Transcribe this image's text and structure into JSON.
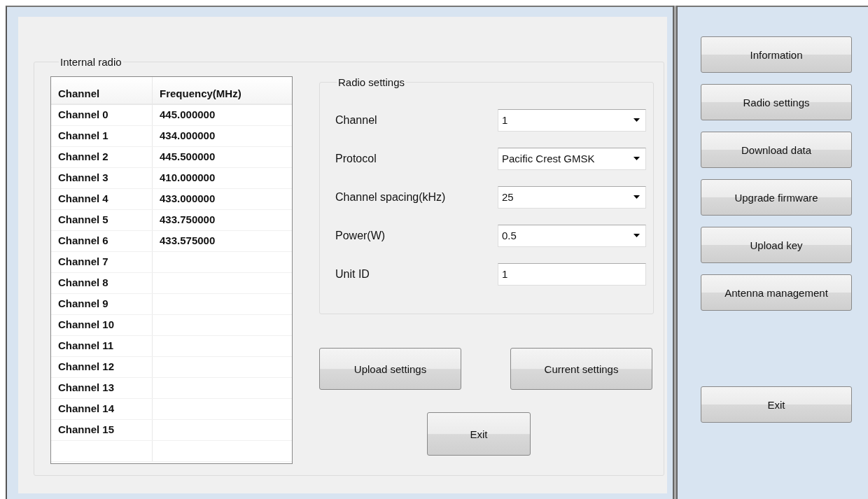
{
  "internal_radio": {
    "title": "Internal radio",
    "table": {
      "columns": [
        "Channel",
        "Frequency(MHz)"
      ],
      "rows": [
        {
          "channel": "Channel 0",
          "frequency": "445.000000"
        },
        {
          "channel": "Channel 1",
          "frequency": "434.000000"
        },
        {
          "channel": "Channel 2",
          "frequency": "445.500000"
        },
        {
          "channel": "Channel 3",
          "frequency": "410.000000"
        },
        {
          "channel": "Channel 4",
          "frequency": "433.000000"
        },
        {
          "channel": "Channel 5",
          "frequency": "433.750000"
        },
        {
          "channel": "Channel 6",
          "frequency": "433.575000"
        },
        {
          "channel": "Channel 7"
        },
        {
          "channel": "Channel 8"
        },
        {
          "channel": "Channel 9"
        },
        {
          "channel": "Channel 10"
        },
        {
          "channel": "Channel 11"
        },
        {
          "channel": "Channel 12"
        },
        {
          "channel": "Channel 13"
        },
        {
          "channel": "Channel 14"
        },
        {
          "channel": "Channel 15"
        }
      ]
    },
    "radio_settings": {
      "title": "Radio settings",
      "fields": [
        {
          "label": "Channel",
          "value": "1",
          "kind": "dropdown"
        },
        {
          "label": "Protocol",
          "value": "Pacific Crest GMSK",
          "kind": "dropdown"
        },
        {
          "label": "Channel spacing(kHz)",
          "value": "25",
          "kind": "dropdown"
        },
        {
          "label": "Power(W)",
          "value": "0.5",
          "kind": "dropdown"
        },
        {
          "label": "Unit ID",
          "value": "1",
          "kind": "text"
        }
      ]
    },
    "buttons": [
      "Upload settings",
      "Current settings"
    ],
    "exit_button": "Exit"
  },
  "sidebar": {
    "buttons": [
      "Information",
      "Radio settings",
      "Download data",
      "Upgrade firmware",
      "Upload key",
      "Antenna management"
    ],
    "exit_button": "Exit"
  }
}
